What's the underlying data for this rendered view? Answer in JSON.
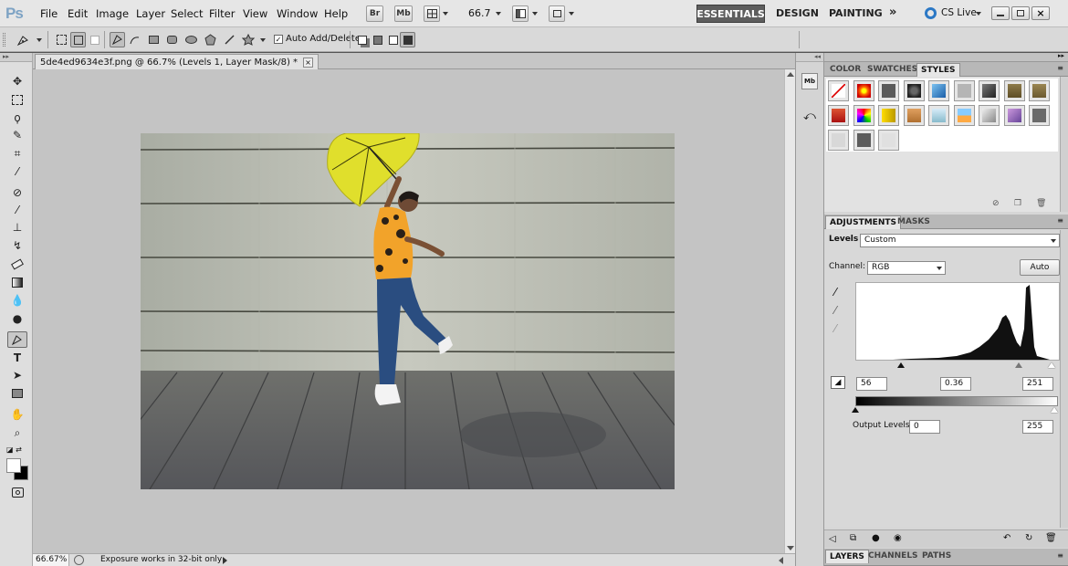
{
  "app": {
    "logo": "Ps"
  },
  "menu": [
    "File",
    "Edit",
    "Image",
    "Layer",
    "Select",
    "Filter",
    "View",
    "Window",
    "Help"
  ],
  "appbar": {
    "bridge": "Br",
    "minibridge": "Mb",
    "zoom": "66.7"
  },
  "workspaces": {
    "essentials": "ESSENTIALS",
    "design": "DESIGN",
    "painting": "PAINTING",
    "more": "»",
    "cslive": "CS Live"
  },
  "options": {
    "auto_add_delete": "Auto Add/Delete"
  },
  "document": {
    "tab_title": "5de4ed9634e3f.png @ 66.7% (Levels 1, Layer Mask/8) *",
    "close": "×"
  },
  "status": {
    "zoom": "66.67%",
    "message": "Exposure works in 32-bit only"
  },
  "panels": {
    "top_tabs": [
      "COLOR",
      "SWATCHES",
      "STYLES"
    ],
    "adj_tabs": [
      "ADJUSTMENTS",
      "MASKS"
    ],
    "bottom_tabs": [
      "LAYERS",
      "CHANNELS",
      "PATHS"
    ]
  },
  "levels": {
    "title": "Levels",
    "preset": "Custom",
    "channel_label": "Channel:",
    "channel": "RGB",
    "auto": "Auto",
    "input_black": "56",
    "input_gamma": "0.36",
    "input_white": "251",
    "output_label": "Output Levels:",
    "output_black": "0",
    "output_white": "255"
  },
  "colors": {
    "accent": "#5e5e5e",
    "umbrella": "#e0df2c",
    "canvas": "#c4c4c4"
  }
}
